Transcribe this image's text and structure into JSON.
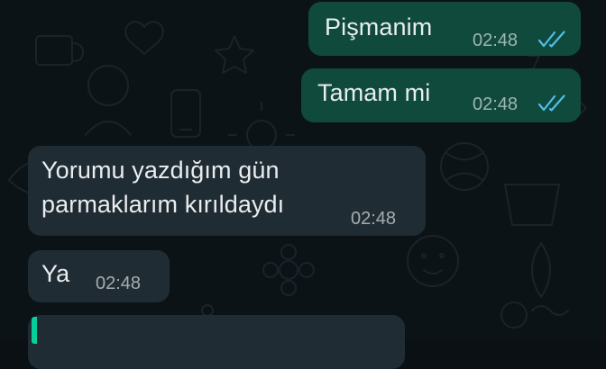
{
  "messages": [
    {
      "direction": "outgoing",
      "text": "Pişmanim",
      "time": "02:48",
      "status_icon": "double-check-read-icon"
    },
    {
      "direction": "outgoing",
      "text": "Tamam mi",
      "time": "02:48",
      "status_icon": "double-check-read-icon"
    },
    {
      "direction": "incoming",
      "lines": [
        "Yorumu yazdığım gün",
        "parmaklarım kırıldaydı"
      ],
      "time": "02:48"
    },
    {
      "direction": "incoming",
      "text": "Ya",
      "time": "02:48"
    }
  ],
  "colors": {
    "background": "#0c1317",
    "outgoing_bubble": "#0f4a3c",
    "incoming_bubble": "#202c33",
    "read_ticks": "#53bdeb",
    "quote_accent": "#06cf9c"
  }
}
